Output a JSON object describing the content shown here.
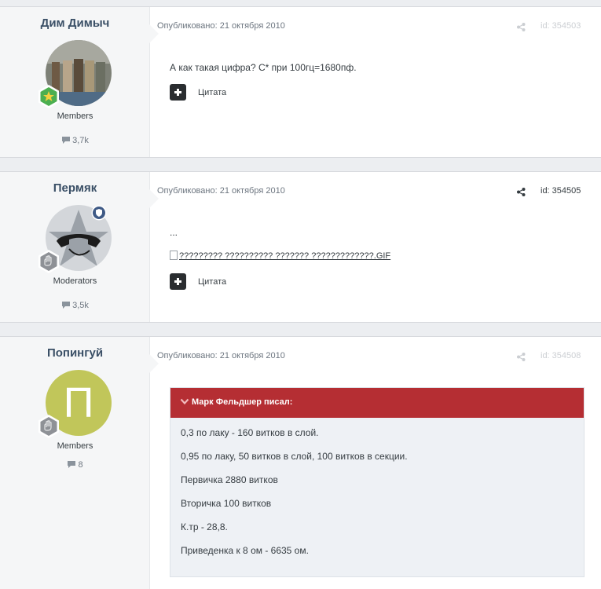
{
  "posts": [
    {
      "author": "Дим Димыч",
      "role": "Members",
      "count": "3,7k",
      "published": "Опубликовано: 21 октября 2010",
      "id": "id: 354503",
      "text": "А как такая цифра? С* при 100гц=1680пф.",
      "quote_label": "Цитата"
    },
    {
      "author": "Пермяк",
      "role": "Moderators",
      "count": "3,5k",
      "published": "Опубликовано: 21 октября 2010",
      "id": "id: 354505",
      "text": "...",
      "image_alt": "????????? ?????????? ??????? ?????????????.GIF",
      "quote_label": "Цитата"
    },
    {
      "author": "Попингуй",
      "role": "Members",
      "count": "8",
      "avatar_letter": "П",
      "published": "Опубликовано: 21 октября 2010",
      "id": "id: 354508",
      "quote_header": "Марк Фельдшер писал:",
      "quote_lines": [
        "0,3 по лаку - 160 витков в слой.",
        "0,95 по лаку, 50 витков в слой, 100 витков в секции.",
        "Первичка 2880 витков",
        "Вторичка 100 витков",
        "К.тр - 28,8.",
        "Приведенка к 8 ом - 6635 ом."
      ]
    }
  ],
  "colors": {
    "accent_quote": "#b52e33",
    "author_name": "#3a4f66",
    "avatar_green": "#c1c65a"
  },
  "icons": [
    "comment-icon",
    "share-icon",
    "star-badge-icon",
    "hand-badge-icon",
    "shield-badge-icon",
    "plus-icon",
    "chevron-down-icon",
    "broken-image-icon"
  ]
}
